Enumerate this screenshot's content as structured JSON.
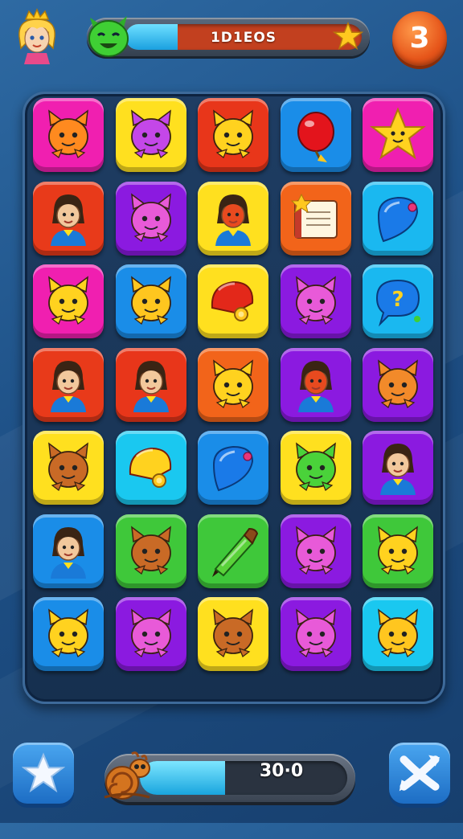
{
  "hud": {
    "progress_label": "1D1EOS",
    "progress_fill": 0.22,
    "level": "3"
  },
  "score": {
    "value": "30·0",
    "fill": 0.41
  },
  "board": {
    "rows": 7,
    "cols": 5,
    "tiles": [
      {
        "bg": "#f01fb0",
        "icon": "cat-face-icon",
        "fg": "#ff8a1f"
      },
      {
        "bg": "#ffe01f",
        "icon": "cat-face-icon",
        "fg": "#c447e8"
      },
      {
        "bg": "#e8361a",
        "icon": "cat-face-icon",
        "fg": "#ffd21f"
      },
      {
        "bg": "#1a8de8",
        "icon": "balloon-icon",
        "fg": "#e3141c"
      },
      {
        "bg": "#f01fb0",
        "icon": "star-icon",
        "fg": "#ffd21f"
      },
      {
        "bg": "#e83a1a",
        "icon": "person-icon",
        "fg": "#f2c89c"
      },
      {
        "bg": "#8b1ae0",
        "icon": "cat-face-icon",
        "fg": "#e85ad8"
      },
      {
        "bg": "#ffe01f",
        "icon": "person-icon",
        "fg": "#e84a1f"
      },
      {
        "bg": "#f2641a",
        "icon": "book-icon",
        "fg": "#ffffff"
      },
      {
        "bg": "#1ab8f0",
        "icon": "shield-icon",
        "fg": "#1a7ae8"
      },
      {
        "bg": "#f01fb0",
        "icon": "cat-face-icon",
        "fg": "#ffd21f"
      },
      {
        "bg": "#1a8de8",
        "icon": "cat-face-icon",
        "fg": "#ffc61f"
      },
      {
        "bg": "#ffe01f",
        "icon": "bell-icon",
        "fg": "#e3281a"
      },
      {
        "bg": "#8b1ae0",
        "icon": "cat-face-icon",
        "fg": "#e85ad8"
      },
      {
        "bg": "#1ab8f0",
        "icon": "speech-bubble-icon",
        "fg": "#1a7ae8"
      },
      {
        "bg": "#e83a1a",
        "icon": "person-icon",
        "fg": "#f2c89c"
      },
      {
        "bg": "#e8361a",
        "icon": "person-icon",
        "fg": "#f2c89c"
      },
      {
        "bg": "#f2641a",
        "icon": "cat-face-icon",
        "fg": "#ffd21f"
      },
      {
        "bg": "#8b1ae0",
        "icon": "person-icon",
        "fg": "#e84a1f"
      },
      {
        "bg": "#8b1ae0",
        "icon": "cat-face-icon",
        "fg": "#f28a2a"
      },
      {
        "bg": "#ffe01f",
        "icon": "cat-face-icon",
        "fg": "#c96a26"
      },
      {
        "bg": "#1ac8f0",
        "icon": "bell-icon",
        "fg": "#ffd21f"
      },
      {
        "bg": "#1a8de8",
        "icon": "shield-icon",
        "fg": "#1a7ae8"
      },
      {
        "bg": "#ffe01f",
        "icon": "cat-face-icon",
        "fg": "#4ad23a"
      },
      {
        "bg": "#8b1ae0",
        "icon": "person-icon",
        "fg": "#f2c89c"
      },
      {
        "bg": "#1a8de8",
        "icon": "person-icon",
        "fg": "#f2c89c"
      },
      {
        "bg": "#3fc83a",
        "icon": "cat-face-icon",
        "fg": "#c96a26"
      },
      {
        "bg": "#3fc83a",
        "icon": "crayon-icon",
        "fg": "#5ad23a"
      },
      {
        "bg": "#8b1ae0",
        "icon": "cat-face-icon",
        "fg": "#e85ad8"
      },
      {
        "bg": "#3fc83a",
        "icon": "cat-face-icon",
        "fg": "#ffd21f"
      },
      {
        "bg": "#1a8de8",
        "icon": "cat-face-icon",
        "fg": "#ffd21f"
      },
      {
        "bg": "#8b1ae0",
        "icon": "cat-face-icon",
        "fg": "#e85ad8"
      },
      {
        "bg": "#ffe01f",
        "icon": "cat-face-icon",
        "fg": "#c96a26"
      },
      {
        "bg": "#8b1ae0",
        "icon": "cat-face-icon",
        "fg": "#e85ad8"
      },
      {
        "bg": "#1ac8f0",
        "icon": "cat-face-icon",
        "fg": "#ffc61f"
      }
    ]
  },
  "buttons": {
    "left": {
      "icon": "star-icon"
    },
    "right": {
      "icon": "shuffle-icon"
    }
  }
}
